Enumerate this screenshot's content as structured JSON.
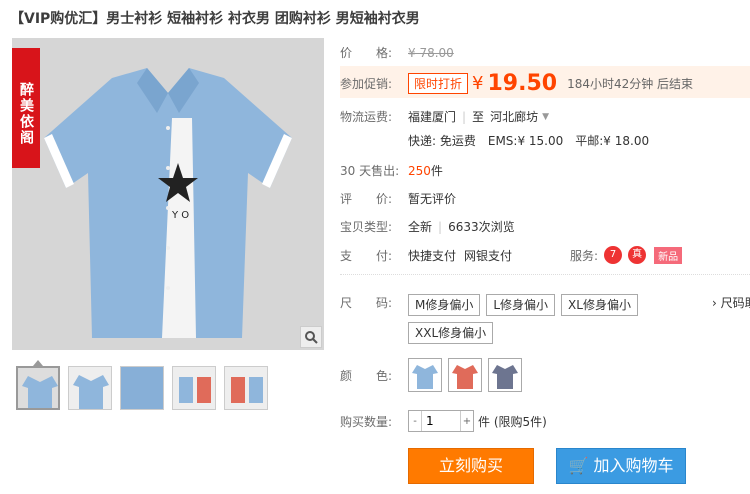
{
  "title": "【VIP购优汇】男士衬衫 短袖衬衫 衬衣男 团购衬衫 男短袖衬衣男",
  "shop_badge": "醉美依阁",
  "price": {
    "label": "价　　格:",
    "original": "¥ 78.00"
  },
  "promo": {
    "label": "参加促销:",
    "tag": "限时打折",
    "yen": "¥",
    "price": "19.50",
    "countdown": "184小时42分钟 后结束"
  },
  "shipping": {
    "label": "物流运费:",
    "from": "福建厦门",
    "to_label": "至",
    "to": "河北廊坊",
    "express": "快递: 免运费",
    "ems": "EMS:¥ 15.00",
    "mail": "平邮:¥ 18.00"
  },
  "sales": {
    "label": "30 天售出:",
    "count": "250",
    "unit": "件"
  },
  "review": {
    "label": "评　　价:",
    "value": "暂无评价"
  },
  "condition": {
    "label": "宝贝类型:",
    "value": "全新",
    "views": "6633次浏览"
  },
  "payment": {
    "label": "支　　付:",
    "methods": [
      "快捷支付",
      "网银支付"
    ],
    "service_label": "服务:",
    "new_tag": "新品"
  },
  "size": {
    "label": "尺　　码:",
    "options": [
      "M修身偏小",
      "L修身偏小",
      "XL修身偏小",
      "XXL修身偏小"
    ],
    "helper": "› 尺码助手"
  },
  "color": {
    "label": "颜　　色:"
  },
  "quantity": {
    "label": "购买数量:",
    "value": "1",
    "limit": "件 (限购5件)"
  },
  "actions": {
    "buy": "立刻购买",
    "cart": "加入购物车"
  },
  "colors": {
    "accent": "#ff4400",
    "buy": "#ff7a00",
    "cart": "#3b9be2",
    "shirt": "#8fb6dc"
  }
}
